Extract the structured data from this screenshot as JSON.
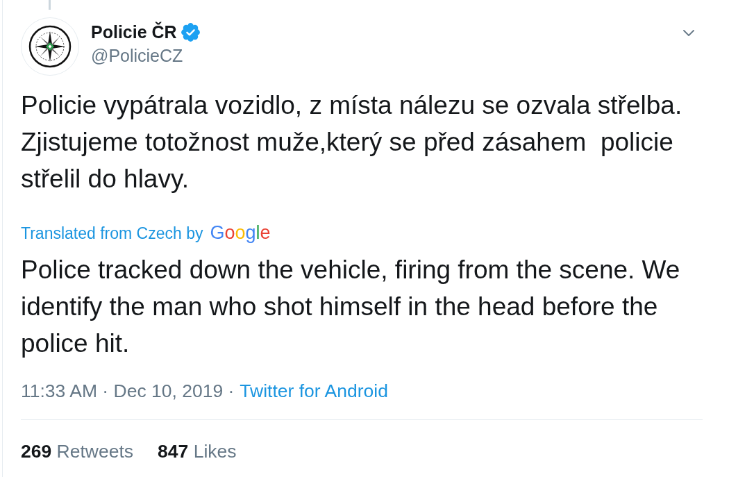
{
  "author": {
    "name": "Policie ČR",
    "verified": true,
    "handle": "@PolicieCZ"
  },
  "tweet": {
    "text": "Policie vypátrala vozidlo, z místa nálezu se ozvala střelba. Zjistujeme totožnost muže,který se před zásahem  policie střelil do hlavy.",
    "translation_label": "Translated from Czech by",
    "translator": "Google",
    "translation": "Police tracked down the vehicle, firing from the scene. We identify the man who shot himself in the head before the police hit."
  },
  "meta": {
    "timestamp": "11:33 AM · Dec 10, 2019 ·",
    "source": "Twitter for Android"
  },
  "stats": [
    {
      "count": "269",
      "label": "Retweets"
    },
    {
      "count": "847",
      "label": "Likes"
    }
  ]
}
